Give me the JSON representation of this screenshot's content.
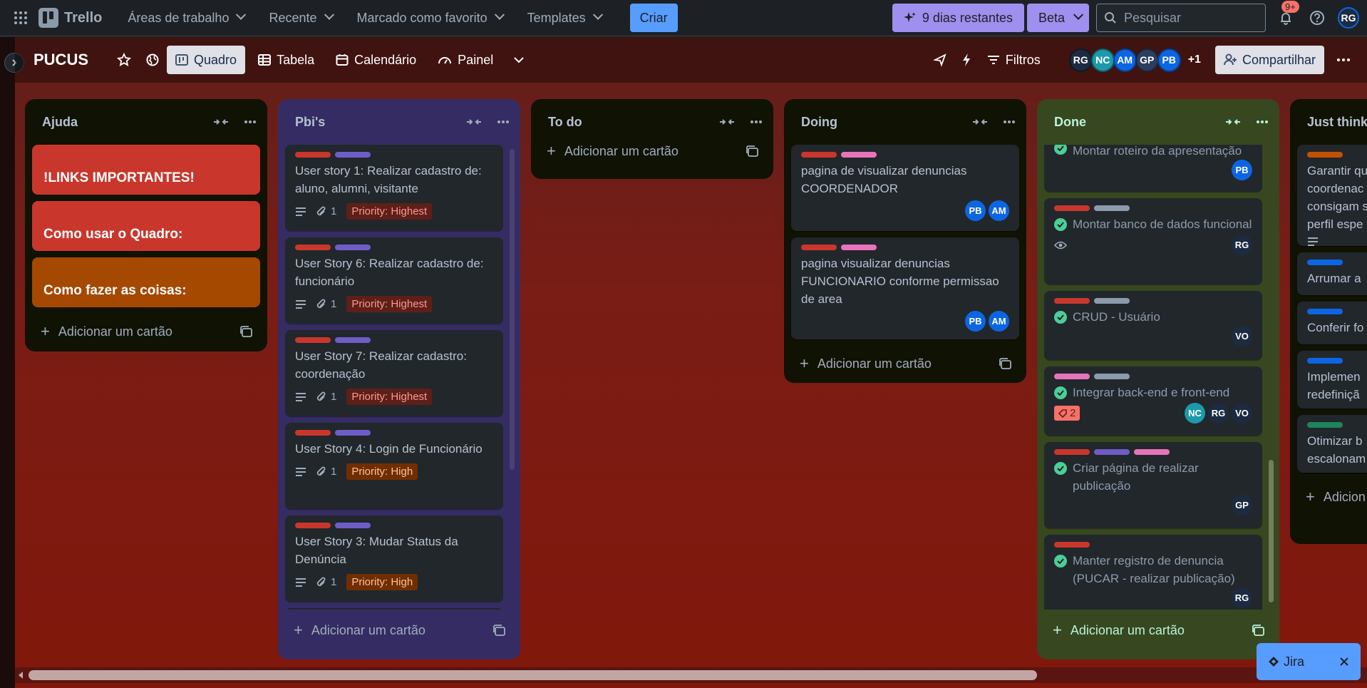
{
  "topnav": {
    "app_name": "Trello",
    "menu": [
      {
        "label": "Áreas de trabalho"
      },
      {
        "label": "Recente"
      },
      {
        "label": "Marcado como favorito"
      },
      {
        "label": "Templates"
      }
    ],
    "create_label": "Criar",
    "trial_label": "9 dias restantes",
    "beta_label": "Beta",
    "search_placeholder": "Pesquisar",
    "notifications_badge": "9+",
    "user_initials": "RG"
  },
  "board": {
    "name": "PUCUS",
    "views": [
      {
        "label": "Quadro"
      },
      {
        "label": "Tabela"
      },
      {
        "label": "Calendário"
      },
      {
        "label": "Painel"
      }
    ],
    "filters_label": "Filtros",
    "members": [
      "RG",
      "NC",
      "AM",
      "GP",
      "PB"
    ],
    "members_more": "+1",
    "share_label": "Compartilhar"
  },
  "colors": {
    "label_red": "#c9372c",
    "label_purple": "#6e5dc6",
    "label_pink": "#e774bb",
    "label_gray": "#8c9bab",
    "label_orange": "#c25100",
    "label_blue": "#0c66e4",
    "label_green": "#1f845a",
    "priority_highest_bg": "#5d1f1a",
    "priority_highest_fg": "#fd9891",
    "priority_high_bg": "#702e00",
    "priority_high_fg": "#fec195"
  },
  "add_card_label": "Adicionar um cartão",
  "lists": {
    "ajuda": {
      "title": "Ajuda",
      "cards": [
        {
          "title": "!LINKS IMPORTANTES!"
        },
        {
          "title": "Como usar o Quadro:"
        },
        {
          "title": "Como fazer as coisas:"
        }
      ]
    },
    "pbis": {
      "title": "Pbi's",
      "cards": [
        {
          "title": "User story 1: Realizar cadastro de: aluno, alumni, visitante",
          "attachments": "1",
          "priority": "Priority: Highest"
        },
        {
          "title": "User Story 6: Realizar cadastro de: funcionário",
          "attachments": "1",
          "priority": "Priority: Highest"
        },
        {
          "title": "User Story 7: Realizar cadastro: coordenação",
          "attachments": "1",
          "priority": "Priority: Highest"
        },
        {
          "title": "User Story 4: Login de Funcionário",
          "attachments": "1",
          "priority": "Priority: High"
        },
        {
          "title": "User Story 3: Mudar Status da Denúncia",
          "attachments": "1",
          "priority": "Priority: High"
        }
      ]
    },
    "todo": {
      "title": "To do"
    },
    "doing": {
      "title": "Doing",
      "cards": [
        {
          "title": "pagina de visualizar denuncias COORDENADOR",
          "members": [
            "PB",
            "AM"
          ]
        },
        {
          "title": "pagina visualizar denuncias FUNCIONARIO conforme permissao de area",
          "members": [
            "PB",
            "AM"
          ]
        }
      ]
    },
    "done": {
      "title": "Done",
      "cards": [
        {
          "title": "Montar roteiro da apresentação",
          "members": [
            "PB"
          ]
        },
        {
          "title": "Montar banco de dados funcional",
          "members": [
            "RG"
          ]
        },
        {
          "title": "CRUD - Usuário",
          "members": [
            "VO"
          ]
        },
        {
          "title": "Integrar back-end e front-end",
          "badge": "2",
          "members": [
            "NC",
            "RG",
            "VO"
          ]
        },
        {
          "title": "Criar página de realizar publicação",
          "members": [
            "GP"
          ]
        },
        {
          "title": "Manter registro de denuncia (PUCAR - realizar publicação)",
          "members": [
            "RG"
          ]
        }
      ]
    },
    "just": {
      "title": "Just thinki",
      "cards": [
        {
          "title": "Garantir qu coordenac consigam s perfil espe"
        },
        {
          "title": "Arrumar a"
        },
        {
          "title": "Conferir fo"
        },
        {
          "title": "Implemen redefiniçã"
        },
        {
          "title": "Otimizar b escalonam"
        }
      ],
      "add_label": "Adicion"
    }
  },
  "jira_label": "Jira"
}
